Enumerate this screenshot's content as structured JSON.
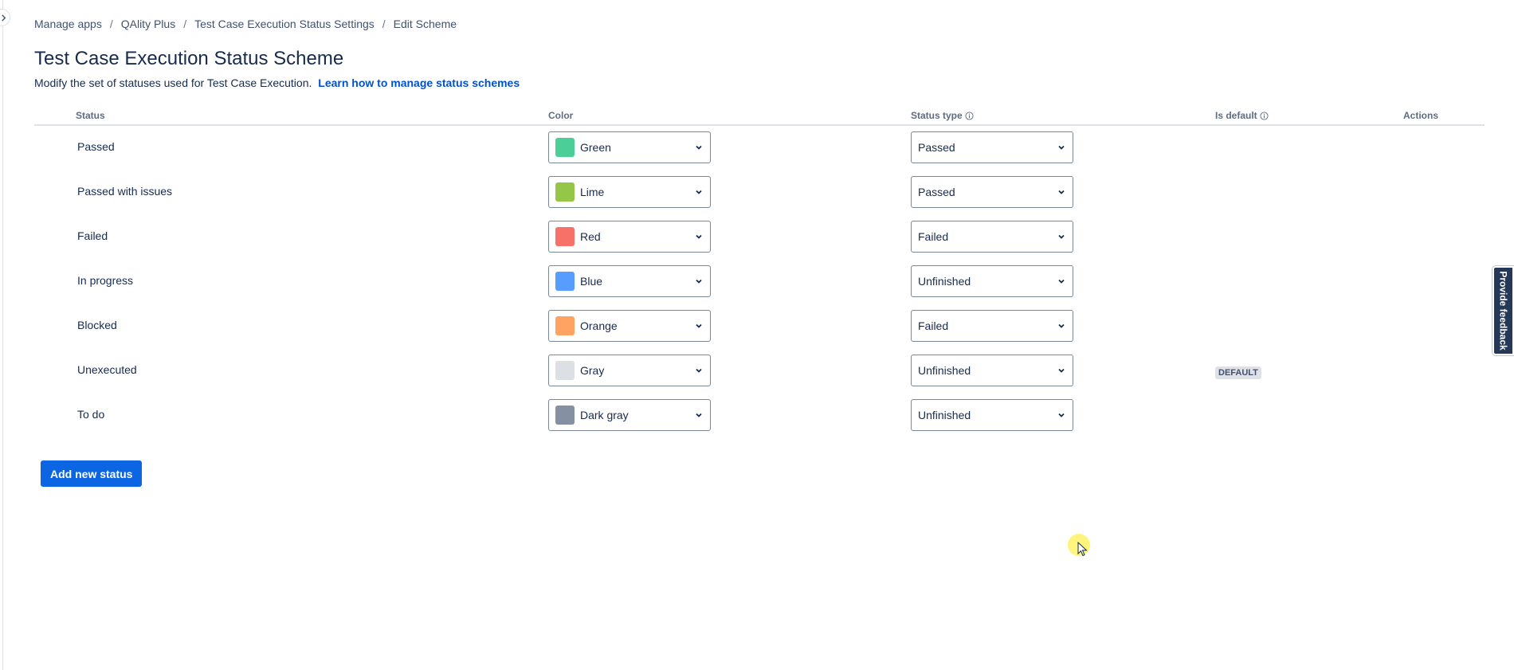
{
  "breadcrumb": [
    "Manage apps",
    "QAlity Plus",
    "Test Case Execution Status Settings",
    "Edit Scheme"
  ],
  "page": {
    "title": "Test Case Execution Status Scheme",
    "description": "Modify the set of statuses used for Test Case Execution.",
    "learn_link": "Learn how to manage status schemes"
  },
  "table": {
    "headers": {
      "status": "Status",
      "color": "Color",
      "status_type": "Status type",
      "is_default": "Is default",
      "actions": "Actions"
    },
    "rows": [
      {
        "name": "Passed",
        "color_name": "Green",
        "color_hex": "#4bce97",
        "status_type": "Passed",
        "is_default": ""
      },
      {
        "name": "Passed with issues",
        "color_name": "Lime",
        "color_hex": "#94c748",
        "status_type": "Passed",
        "is_default": ""
      },
      {
        "name": "Failed",
        "color_name": "Red",
        "color_hex": "#f87168",
        "status_type": "Failed",
        "is_default": ""
      },
      {
        "name": "In progress",
        "color_name": "Blue",
        "color_hex": "#579dff",
        "status_type": "Unfinished",
        "is_default": ""
      },
      {
        "name": "Blocked",
        "color_name": "Orange",
        "color_hex": "#fea362",
        "status_type": "Failed",
        "is_default": ""
      },
      {
        "name": "Unexecuted",
        "color_name": "Gray",
        "color_hex": "#dcdfe4",
        "status_type": "Unfinished",
        "is_default": "DEFAULT"
      },
      {
        "name": "To do",
        "color_name": "Dark gray",
        "color_hex": "#8590a2",
        "status_type": "Unfinished",
        "is_default": ""
      }
    ]
  },
  "add_button": "Add new status",
  "feedback_tab": "Provide feedback",
  "icons": {
    "expand": "chevron-right-icon",
    "dropdown": "chevron-down-icon",
    "info": "info-icon"
  }
}
